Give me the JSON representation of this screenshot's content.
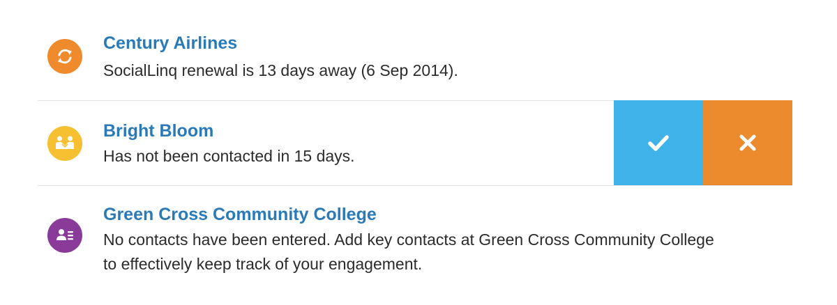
{
  "colors": {
    "title": "#2a7ab8",
    "text": "#2b2b2b",
    "divider": "#e4e4e4",
    "confirm": "#3fb3e9",
    "dismiss": "#ec8a2e"
  },
  "items": [
    {
      "icon": "refresh-icon",
      "icon_color": "#ef8a2d",
      "title": "Century Airlines",
      "description": "SocialLinq renewal is 13 days away (6 Sep 2014)."
    },
    {
      "icon": "handshake-icon",
      "icon_color": "#f7c032",
      "title": "Bright Bloom",
      "description": "Has not been contacted in 15 days."
    },
    {
      "icon": "contact-card-icon",
      "icon_color": "#8a3a98",
      "title": "Green Cross Community College",
      "description": "No contacts have been entered. Add key contacts at Green Cross Community College to effectively keep track of your engagement."
    }
  ],
  "actions": {
    "confirm_icon": "checkmark-icon",
    "dismiss_icon": "close-icon"
  }
}
